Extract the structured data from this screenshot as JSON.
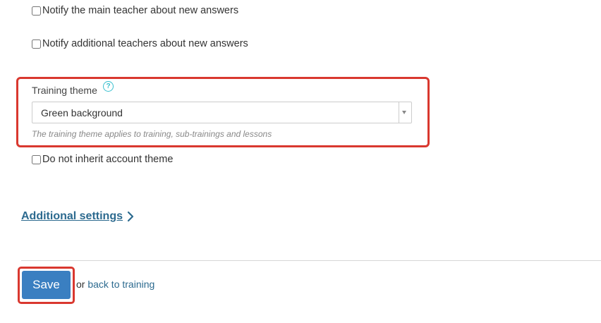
{
  "notifications": {
    "main_teacher_label": "Notify the main teacher about new answers",
    "additional_teachers_label": "Notify additional teachers about new answers"
  },
  "theme": {
    "label": "Training theme",
    "help_icon": "?",
    "selected_value": "Green background",
    "hint": "The training theme applies to training, sub-trainings and lessons",
    "do_not_inherit_label": "Do not inherit account theme"
  },
  "additional_settings": {
    "label": "Additional settings",
    "icon": "chevron-right-icon"
  },
  "footer": {
    "save_label": "Save",
    "or_text": "or",
    "back_link_label": "back to training"
  },
  "colors": {
    "highlight": "#d9382f",
    "save_button": "#3a7fc1",
    "link": "#2c6a8f",
    "help_icon": "#39c0cf"
  }
}
